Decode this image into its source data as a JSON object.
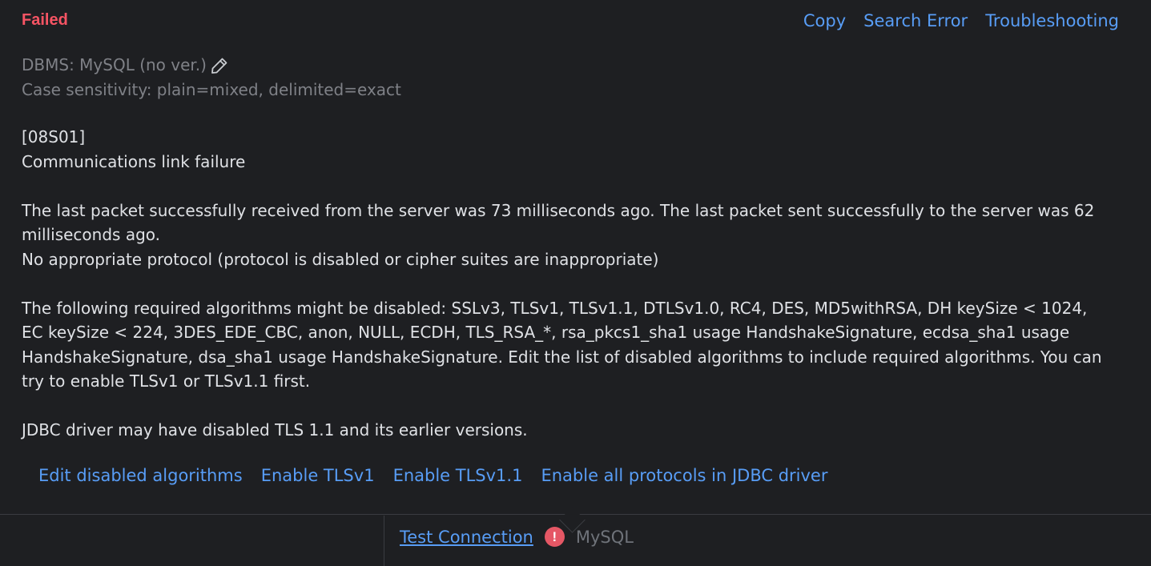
{
  "status": "Failed",
  "actions": {
    "copy": "Copy",
    "search_error": "Search Error",
    "troubleshooting": "Troubleshooting"
  },
  "meta": {
    "dbms": "DBMS: MySQL (no ver.)",
    "case_sensitivity": "Case sensitivity: plain=mixed, delimited=exact"
  },
  "error": {
    "code": "[08S01]",
    "title": "Communications link failure",
    "packet_info": "The last packet successfully received from the server was 73 milliseconds ago. The last packet sent successfully to the server was 62 milliseconds ago.",
    "protocol_msg": "No appropriate protocol (protocol is disabled or cipher suites are inappropriate)",
    "algorithms_msg": "The following required algorithms might be disabled: SSLv3, TLSv1, TLSv1.1, DTLSv1.0, RC4, DES, MD5withRSA, DH keySize < 1024, EC keySize < 224, 3DES_EDE_CBC, anon, NULL, ECDH, TLS_RSA_*, rsa_pkcs1_sha1 usage HandshakeSignature, ecdsa_sha1 usage HandshakeSignature, dsa_sha1 usage HandshakeSignature. Edit the list of disabled algorithms to include required algorithms. You can try to enable TLSv1 or TLSv1.1 first.",
    "jdbc_msg": "JDBC driver may have disabled TLS 1.1 and its earlier versions."
  },
  "fixes": {
    "edit_algorithms": "Edit disabled algorithms",
    "enable_tlsv1": "Enable TLSv1",
    "enable_tlsv11": "Enable TLSv1.1",
    "enable_all": "Enable all protocols in JDBC driver"
  },
  "bottom": {
    "test_connection": "Test Connection",
    "error_badge": "!",
    "driver": "MySQL"
  },
  "colors": {
    "background": "#1e1f22",
    "error": "#f75464",
    "link": "#589df6",
    "text": "#dfe1e5",
    "muted": "#7f8187"
  },
  "icons": {
    "edit": "pencil-icon",
    "error": "error-icon"
  }
}
